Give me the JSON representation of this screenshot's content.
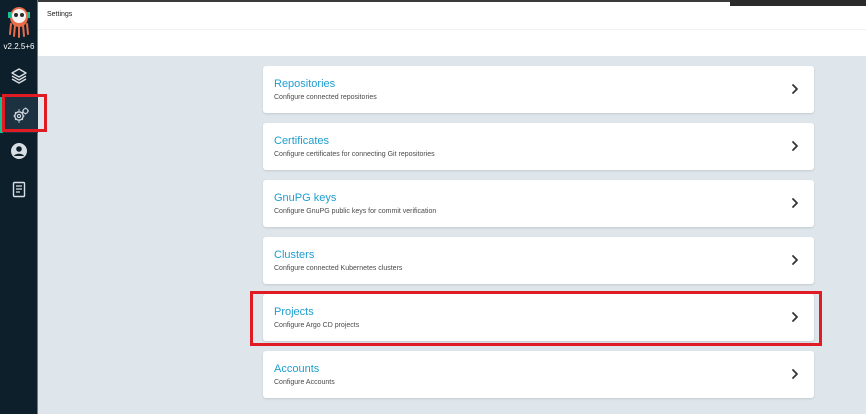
{
  "app": {
    "version": "v2.2.5+6"
  },
  "header": {
    "title": "Settings"
  },
  "sidebar": {
    "items": [
      {
        "icon": "layers-icon",
        "label": "Applications"
      },
      {
        "icon": "gear-icon",
        "label": "Settings",
        "active": true
      },
      {
        "icon": "user-icon",
        "label": "User Info"
      },
      {
        "icon": "docs-icon",
        "label": "Documentation"
      }
    ]
  },
  "settings": {
    "cards": [
      {
        "title": "Repositories",
        "description": "Configure connected repositories"
      },
      {
        "title": "Certificates",
        "description": "Configure certificates for connecting Git repositories"
      },
      {
        "title": "GnuPG keys",
        "description": "Configure GnuPG public keys for commit verification"
      },
      {
        "title": "Clusters",
        "description": "Configure connected Kubernetes clusters"
      },
      {
        "title": "Projects",
        "description": "Configure Argo CD projects"
      },
      {
        "title": "Accounts",
        "description": "Configure Accounts"
      }
    ]
  },
  "colors": {
    "sidebar_bg": "#0e1f2c",
    "content_bg": "#dee6eb",
    "link": "#1e9dcf",
    "highlight": "#e01b24",
    "active_accent": "#18be94"
  }
}
